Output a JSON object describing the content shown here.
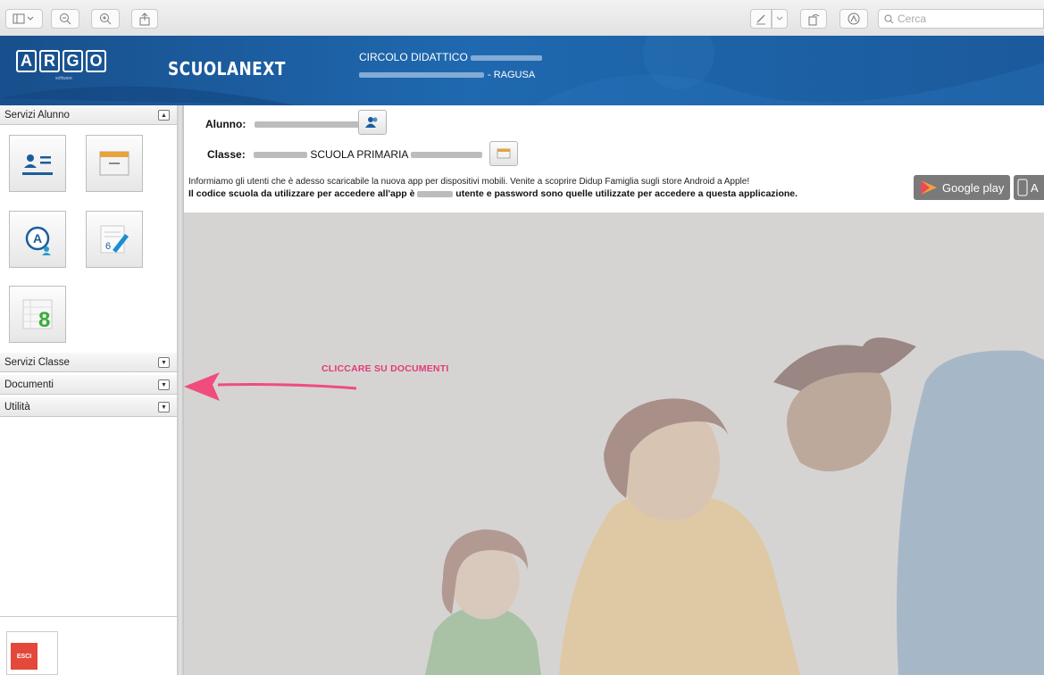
{
  "toolbar": {
    "search_placeholder": "Cerca",
    "icons": [
      "sidebar-icon",
      "zoom-out-icon",
      "zoom-in-icon",
      "share-icon",
      "pen-icon",
      "chevron-down-icon",
      "rotate-icon",
      "annotate-icon",
      "search-icon"
    ]
  },
  "banner": {
    "logo_letters": [
      "A",
      "R",
      "G",
      "O"
    ],
    "logo_sub": "software",
    "brand": "SCUOLANEXT",
    "school_line1": "CIRCOLO DIDATTICO",
    "school_line2_suffix": "- RAGUSA"
  },
  "sidebar": {
    "section_servizi_alunno": "Servizi Alunno",
    "section_servizi_classe": "Servizi Classe",
    "section_documenti": "Documenti",
    "section_utilita": "Utilità",
    "esci_label": "ESCI",
    "tiles": [
      "anagrafe-icon",
      "folder-icon",
      "assenze-icon",
      "compiti-icon",
      "voti-icon"
    ]
  },
  "info": {
    "alunno_label": "Alunno:",
    "classe_label": "Classe:",
    "classe_value": "SCUOLA PRIMARIA",
    "line1": "Informiamo gli utenti che è adesso scaricabile la nuova app per dispositivi mobili. Venite a scoprire Didup Famiglia sugli store Android a Apple!",
    "line2_a": "Il codice scuola da utilizzare per accedere all'app è",
    "line2_b": "utente e password sono quelle utilizzate per accedere a questa applicazione.",
    "google_play": "Google play",
    "app_store": "A"
  },
  "main": {
    "hint": "CLICCARE SU DOCUMENTI",
    "colors": {
      "hint": "#e33a79",
      "arrow": "#f04d7e"
    }
  }
}
